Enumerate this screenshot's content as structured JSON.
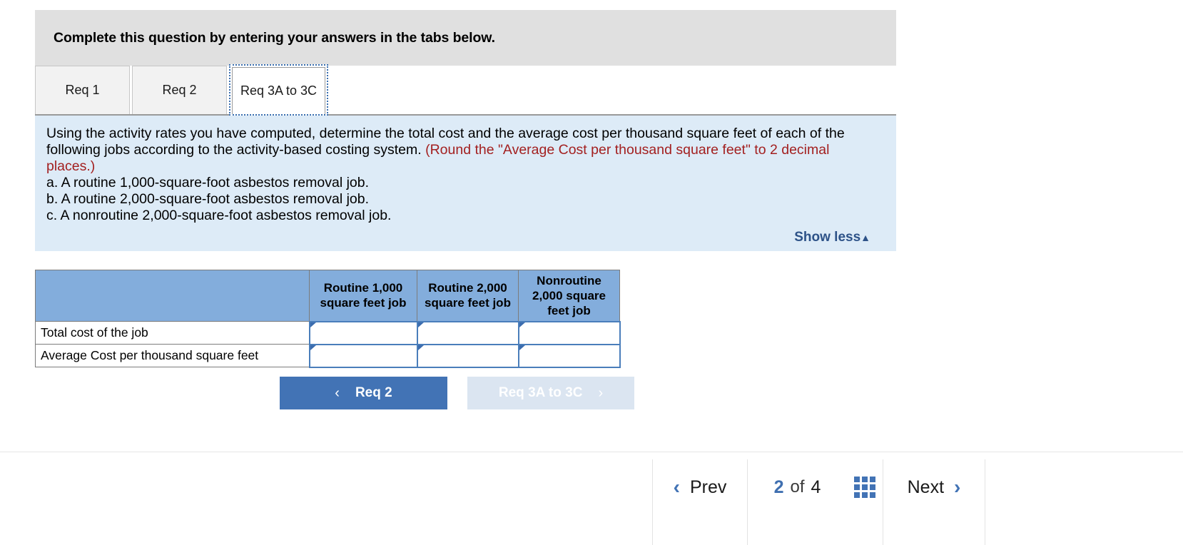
{
  "banner": {
    "text": "Complete this question by entering your answers in the tabs below."
  },
  "tabs": [
    {
      "label": "Req 1",
      "active": false
    },
    {
      "label": "Req 2",
      "active": false
    },
    {
      "label": "Req 3A to 3C",
      "active": true
    }
  ],
  "instruction": {
    "line1_part1": "Using the activity rates you have computed, determine the total cost and the average cost per thousand square feet of each of the following jobs according to the activity-based costing system. ",
    "line1_red": "(Round the \"Average Cost per thousand square feet\" to 2 decimal places.)",
    "items": [
      "a. A routine 1,000-square-foot asbestos removal job.",
      "b. A routine 2,000-square-foot asbestos removal job.",
      "c. A nonroutine 2,000-square-foot asbestos removal job."
    ],
    "show_less_label": "Show less",
    "show_less_caret": "▲"
  },
  "table": {
    "headers": [
      "",
      "Routine 1,000 square feet job",
      "Routine 2,000 square feet job",
      "Nonroutine 2,000 square feet job"
    ],
    "rows": [
      {
        "label": "Total cost of the job",
        "values": [
          "",
          "",
          ""
        ]
      },
      {
        "label": "Average Cost per thousand square feet",
        "values": [
          "",
          "",
          ""
        ]
      }
    ],
    "input_placeholder": ""
  },
  "req_nav": {
    "prev_label": "Req 2",
    "prev_chevron": "‹",
    "next_label": "Req 3A to 3C",
    "next_chevron": "›"
  },
  "pager": {
    "prev_label": "Prev",
    "prev_chevron": "‹",
    "current_page": "2",
    "of_label": "of",
    "total_pages": "4",
    "grid_icon": "grid-icon",
    "next_label": "Next",
    "next_chevron": "›"
  },
  "colors": {
    "banner_bg": "#e0e0e0",
    "instruction_bg": "#ddebf7",
    "table_header_bg": "#83ADDC",
    "accent_blue": "#4273b5",
    "red_note": "#a32020",
    "disabled_btn": "#dbe5f1"
  }
}
